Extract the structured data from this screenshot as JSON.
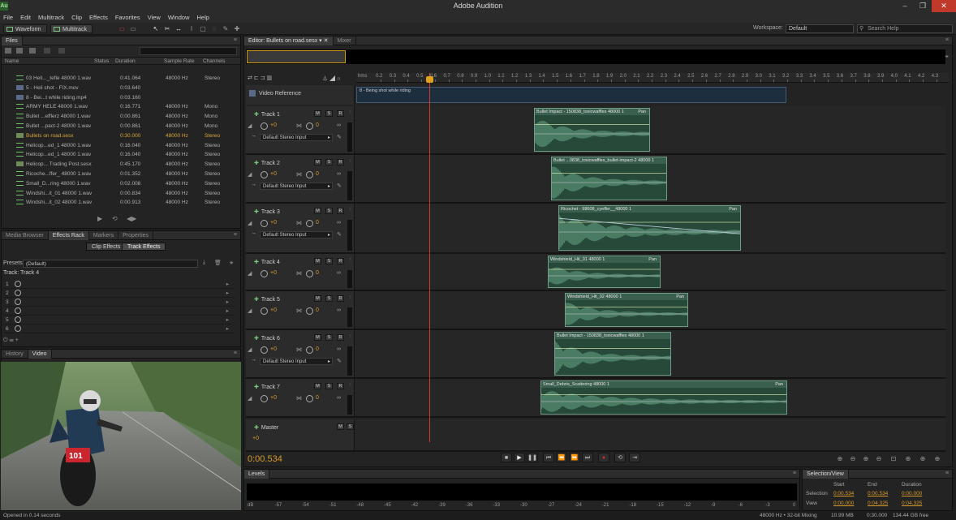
{
  "app": {
    "title": "Adobe Audition",
    "icon_label": "Au"
  },
  "window_controls": [
    "–",
    "❐",
    "✕"
  ],
  "menu": [
    "File",
    "Edit",
    "Multitrack",
    "Clip",
    "Effects",
    "Favorites",
    "View",
    "Window",
    "Help"
  ],
  "toolbar": {
    "waveform": "Waveform",
    "multitrack": "Multitrack",
    "workspace_label": "Workspace:",
    "workspace_value": "Default",
    "search_placeholder": "Search Help"
  },
  "files_panel": {
    "tab": "Files",
    "columns": [
      "Name",
      "Status",
      "Duration",
      "Sample Rate",
      "Channels"
    ],
    "rows": [
      {
        "name": "03 Heli..._tefle 48000 1.wav",
        "duration": "0:41.064",
        "rate": "48000 Hz",
        "channels": "Stereo",
        "type": "audio"
      },
      {
        "name": "5 - Heli shot - FIX.mov",
        "duration": "0:03.640",
        "rate": "",
        "channels": "",
        "type": "video"
      },
      {
        "name": "8 - Bei...t while riding.mp4",
        "duration": "0:03.160",
        "rate": "",
        "channels": "",
        "type": "video"
      },
      {
        "name": "ARMY HELE 48000 1.wav",
        "duration": "0:16.771",
        "rate": "48000 Hz",
        "channels": "Mono",
        "type": "audio"
      },
      {
        "name": "Bullet ...efflerz 48000 1.wav",
        "duration": "0:00.861",
        "rate": "48000 Hz",
        "channels": "Mono",
        "type": "audio"
      },
      {
        "name": "Bullet ...pact-2 48000 1.wav",
        "duration": "0:00.861",
        "rate": "48000 Hz",
        "channels": "Mono",
        "type": "audio"
      },
      {
        "name": "Bullets on road.sesx",
        "duration": "0:30.000",
        "rate": "48000 Hz",
        "channels": "Stereo",
        "type": "session",
        "selected": true
      },
      {
        "name": "Helicop...ed_1 48000 1.wav",
        "duration": "0:16.040",
        "rate": "48000 Hz",
        "channels": "Stereo",
        "type": "audio"
      },
      {
        "name": "Helicop...ed_1 48000 1.wav",
        "duration": "0:16.040",
        "rate": "48000 Hz",
        "channels": "Stereo",
        "type": "audio"
      },
      {
        "name": "Helicop... Trading Post.sesx",
        "duration": "0:45.170",
        "rate": "48000 Hz",
        "channels": "Stereo",
        "type": "session"
      },
      {
        "name": "Ricoche...ffer_ 48000 1.wav",
        "duration": "0:01.352",
        "rate": "48000 Hz",
        "channels": "Stereo",
        "type": "audio"
      },
      {
        "name": "Small_D...ring 48000 1.wav",
        "duration": "0:02.008",
        "rate": "48000 Hz",
        "channels": "Stereo",
        "type": "audio"
      },
      {
        "name": "Windshi...it_01 48000 1.wav",
        "duration": "0:00.834",
        "rate": "48000 Hz",
        "channels": "Stereo",
        "type": "audio"
      },
      {
        "name": "Windshi...it_02 48000 1.wav",
        "duration": "0:00.913",
        "rate": "48000 Hz",
        "channels": "Stereo",
        "type": "audio"
      }
    ]
  },
  "fx_panel": {
    "tabs": [
      "Media Browser",
      "Effects Rack",
      "Markers",
      "Properties"
    ],
    "subtabs": [
      "Clip Effects",
      "Track Effects"
    ],
    "presets_label": "Presets:",
    "presets_value": "(Default)",
    "track_label": "Track: Track 4",
    "slots": [
      "1",
      "2",
      "3",
      "4",
      "5",
      "6"
    ]
  },
  "video_panel": {
    "tabs": [
      "History",
      "Video"
    ],
    "bib": "101"
  },
  "editor": {
    "tabs": [
      "Editor: Bullets on road.sesx",
      "Mixer"
    ],
    "ruler_unit": "hms",
    "ruler_ticks": [
      "0.2",
      "0.3",
      "0.4",
      "0.5",
      "0.6",
      "0.7",
      "0.8",
      "0.9",
      "1.0",
      "1.1",
      "1.2",
      "1.3",
      "1.4",
      "1.5",
      "1.6",
      "1.7",
      "1.8",
      "1.9",
      "2.0",
      "2.1",
      "2.2",
      "2.3",
      "2.4",
      "2.5",
      "2.6",
      "2.7",
      "2.8",
      "2.9",
      "3.0",
      "3.1",
      "3.2",
      "3.3",
      "3.4",
      "3.5",
      "3.6",
      "3.7",
      "3.8",
      "3.9",
      "4.0",
      "4.1",
      "4.2",
      "4.3"
    ],
    "video_reference": {
      "label": "Video Reference",
      "clip": "8 - Being shot while riding"
    },
    "default_input": "Default Stereo Input",
    "volume": "+0",
    "pan": "0",
    "tracks": [
      {
        "name": "Track 1",
        "clip": "Bullet Impact - 150838_toxicwaffles 48000 1",
        "param": "Pan"
      },
      {
        "name": "Track 2",
        "clip": "Bullet ...0838_toxicwaffles_bullet-impact-2 48000 1",
        "param": ""
      },
      {
        "name": "Track 3",
        "clip": "Ricochet - 98608_cyeffer__48000 1",
        "param": "Pan"
      },
      {
        "name": "Track 4",
        "clip": "Windshield_Hit_01 48000 1",
        "param": "Pan"
      },
      {
        "name": "Track 5",
        "clip": "Windshield_Hit_02 48000 1",
        "param": "Pan"
      },
      {
        "name": "Track 6",
        "clip": "Bullet Impact - 150838_toxicwaffles 48000 1",
        "param": ""
      },
      {
        "name": "Track 7",
        "clip": "Small_Debris_Scattering 48000 1",
        "param": "Pan"
      }
    ],
    "master": "Master",
    "current_time": "0:00.534"
  },
  "levels": {
    "tab": "Levels",
    "scale": [
      "dB",
      "-57",
      "-54",
      "-51",
      "-48",
      "-45",
      "-42",
      "-39",
      "-36",
      "-33",
      "-30",
      "-27",
      "-24",
      "-21",
      "-18",
      "-15",
      "-12",
      "-9",
      "-6",
      "-3",
      "0"
    ]
  },
  "selection_view": {
    "tab": "Selection/View",
    "headers": [
      "Start",
      "End",
      "Duration"
    ],
    "selection": {
      "label": "Selection",
      "start": "0:00.534",
      "end": "0:00.534",
      "duration": "0:00.000"
    },
    "view": {
      "label": "View",
      "start": "0:00.000",
      "end": "0:04.325",
      "duration": "0:04.325"
    }
  },
  "status": {
    "left": "Opened in 0.14 seconds",
    "format": "48000 Hz • 32-bit Mixing",
    "memory": "10.99 MB",
    "duration": "0:30.000",
    "free": "134.44 GB free"
  }
}
